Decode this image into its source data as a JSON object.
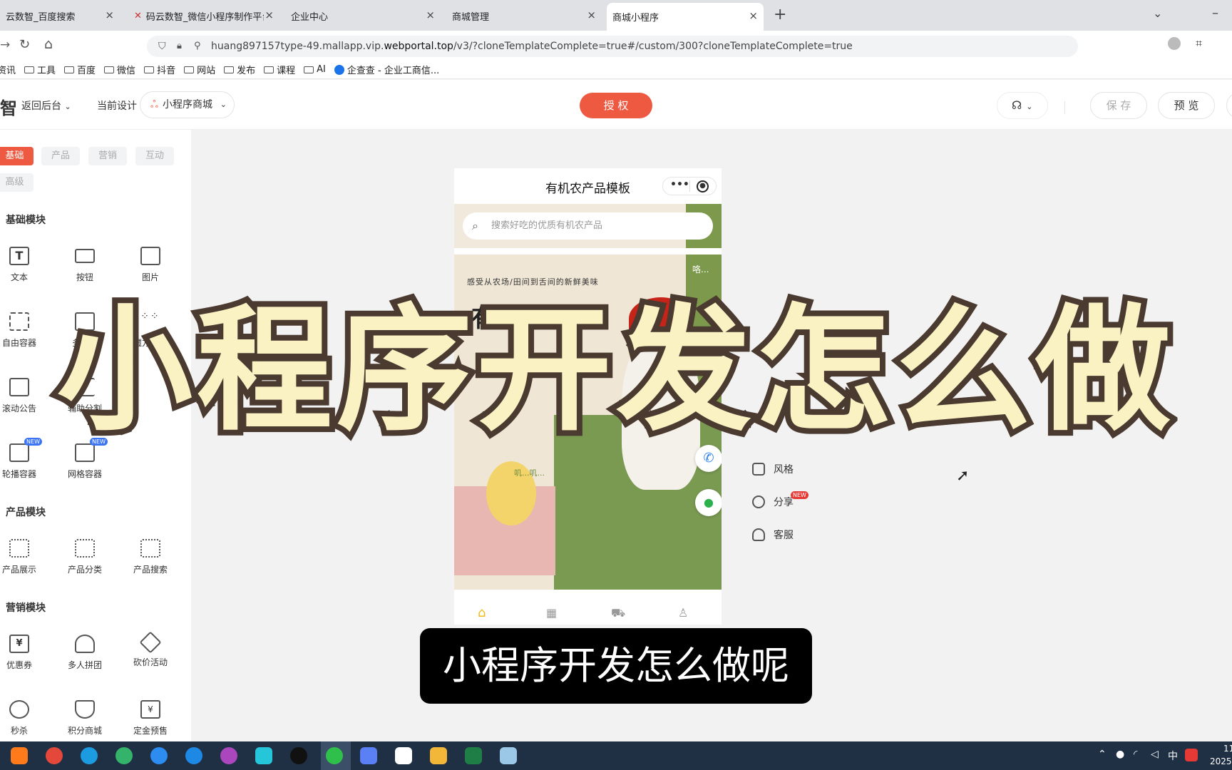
{
  "browser": {
    "tabs": [
      {
        "label": "云数智_百度搜索"
      },
      {
        "label": "码云数智_微信小程序制作平台_"
      },
      {
        "label": "企业中心"
      },
      {
        "label": "商城管理"
      },
      {
        "label": "商城小程序"
      }
    ],
    "url_prefix": "huang897157type-49.mallapp.vip.",
    "url_domain": "webportal.top",
    "url_rest": "/v3/?cloneTemplateComplete=true#/custom/300?cloneTemplateComplete=true",
    "bookmarks": [
      "资讯",
      "工具",
      "百度",
      "微信",
      "抖音",
      "网站",
      "发布",
      "课程",
      "AI",
      "企查查 - 企业工商信..."
    ]
  },
  "toolbar": {
    "logo": "智",
    "back_label": "返回后台",
    "current_design_label": "当前设计",
    "design_select": "小程序商城",
    "authorize_label": "授 权",
    "save_label": "保 存",
    "preview_label": "预 览"
  },
  "sidebar": {
    "tabs": [
      "基础",
      "产品",
      "营销",
      "互动",
      "高级"
    ],
    "sections": {
      "basic": "基础模块",
      "product": "产品模块",
      "marketing": "营销模块"
    },
    "basic_items": [
      "文本",
      "按钮",
      "图片",
      "自由容器",
      "多图文",
      "魔方导航",
      "滚动公告",
      "辅助分割",
      "轮播容器",
      "网格容器"
    ],
    "product_items": [
      "产品展示",
      "产品分类",
      "产品搜索"
    ],
    "marketing_items": [
      "优惠券",
      "多人拼团",
      "砍价活动",
      "秒杀",
      "积分商城",
      "定金预售"
    ],
    "new_badge": "NEW"
  },
  "phone": {
    "title": "有机农产品模板",
    "search_placeholder": "搜索好吃的优质有机农产品",
    "banner_small": "感受从农场/田间到舌间的新鲜美味",
    "banner_big": "有机生活",
    "side_text": "咯...",
    "chick_text": "叽...叽..."
  },
  "right_menu": {
    "style": "风格",
    "share": "分享",
    "service": "客服"
  },
  "overlay_title": "小程序开发怎么做",
  "subtitle": "小程序开发怎么做呢",
  "taskbar": {
    "ime": "中",
    "clock_line1": "11",
    "clock_line2": "2025"
  },
  "colors": {
    "accent": "#ee5a41",
    "overlay_fill": "#fbf2c4",
    "overlay_stroke": "#4a3a30",
    "taskbar": "#1f2f44"
  }
}
